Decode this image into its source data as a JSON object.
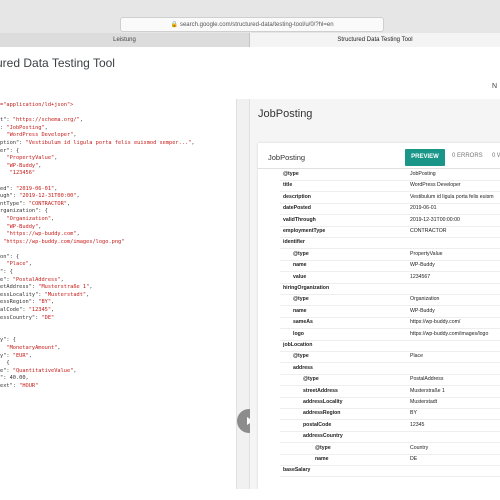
{
  "browser": {
    "url": "search.google.com/structured-data/testing-tool/u/0/?hl=en",
    "tab_left": "Leistung",
    "tab_right": "Structured Data Testing Tool"
  },
  "header": {
    "title": "ured Data Testing Tool",
    "right_letter": "N"
  },
  "code_lines": [
    "<span class=\"s\">=\"application/ld+json\"&gt;</span>",
    "",
    "t\": <span class=\"s\">\"https://schema.org/\"</span>,",
    ": <span class=\"s\">\"JobPosting\"</span>,",
    "  <span class=\"s\">\"WordPress Developer\"</span>,",
    "ption\": <span class=\"s\">\"Vestibulum id ligula porta felis euismod semper...\"</span>,",
    "er\": {",
    "  <span class=\"s\">\"PropertyValue\"</span>,",
    "  <span class=\"s\">\"WP-Buddy\"</span>,",
    "   <span class=\"s\">\"123456\"</span>",
    "",
    "ed\": <span class=\"s\">\"2019-06-01\"</span>,",
    "ugh\": <span class=\"s\">\"2019-12-31T00:00\"</span>,",
    "ntType\": <span class=\"s\">\"CONTRACTOR\"</span>,",
    "rganization\": {",
    "  <span class=\"s\">\"Organization\"</span>,",
    "  <span class=\"s\">\"WP-Buddy\"</span>,",
    "  <span class=\"s\">\"https://wp-buddy.com\"</span>,",
    " <span class=\"s\">\"https://wp-buddy.com/images/logo.png\"</span>",
    "",
    "on\": {",
    "  <span class=\"s\">\"Place\"</span>,",
    "\": {",
    "e\": <span class=\"s\">\"PostalAddress\"</span>,",
    "etAddress\": <span class=\"s\">\"Musterstraße 1\"</span>,",
    "essLocality\": <span class=\"s\">\"Musterstadt\"</span>,",
    "essRegion\": <span class=\"s\">\"BY\"</span>,",
    "alCode\": <span class=\"s\">\"12345\"</span>,",
    "essCountry\": <span class=\"s\">\"DE\"</span>",
    "",
    "",
    "y\": {",
    "  <span class=\"s\">\"MonetaryAmount\"</span>,",
    "y\": <span class=\"s\">\"EUR\"</span>,",
    "  {",
    "e\": <span class=\"s\">\"QuantitativeValue\"</span>,",
    "\": 40.00,",
    "ext\": <span class=\"s\">\"HOUR\"</span>"
  ],
  "results": {
    "title": "JobPosting",
    "card_title": "JobPosting",
    "preview_label": "PREVIEW",
    "errors_label": "0 ERRORS",
    "warnings_label": "0 W",
    "rows": [
      {
        "key": "@type",
        "value": "JobPosting",
        "indent": 0
      },
      {
        "key": "title",
        "value": "WordPress Developer",
        "indent": 0
      },
      {
        "key": "description",
        "value": "Vestibulum id ligula porta felis euism",
        "indent": 0
      },
      {
        "key": "datePosted",
        "value": "2019-06-01",
        "indent": 0
      },
      {
        "key": "validThrough",
        "value": "2019-12-31T00:00:00",
        "indent": 0
      },
      {
        "key": "employmentType",
        "value": "CONTRACTOR",
        "indent": 0
      },
      {
        "key": "identifier",
        "value": "",
        "indent": 0
      },
      {
        "key": "@type",
        "value": "PropertyValue",
        "indent": 1
      },
      {
        "key": "name",
        "value": "WP-Buddy",
        "indent": 1
      },
      {
        "key": "value",
        "value": "1234567",
        "indent": 1
      },
      {
        "key": "hiringOrganization",
        "value": "",
        "indent": 0
      },
      {
        "key": "@type",
        "value": "Organization",
        "indent": 1
      },
      {
        "key": "name",
        "value": "WP-Buddy",
        "indent": 1
      },
      {
        "key": "sameAs",
        "value": "https://wp-buddy.com/",
        "indent": 1
      },
      {
        "key": "logo",
        "value": "https://wp-buddy.com/images/logo",
        "indent": 1
      },
      {
        "key": "jobLocation",
        "value": "",
        "indent": 0
      },
      {
        "key": "@type",
        "value": "Place",
        "indent": 1
      },
      {
        "key": "address",
        "value": "",
        "indent": 1
      },
      {
        "key": "@type",
        "value": "PostalAddress",
        "indent": 2
      },
      {
        "key": "streetAddress",
        "value": "Musterstraße 1",
        "indent": 2
      },
      {
        "key": "addressLocality",
        "value": "Musterstadt",
        "indent": 2
      },
      {
        "key": "addressRegion",
        "value": "BY",
        "indent": 2
      },
      {
        "key": "postalCode",
        "value": "12345",
        "indent": 2
      },
      {
        "key": "addressCountry",
        "value": "",
        "indent": 2
      },
      {
        "key": "@type",
        "value": "Country",
        "indent": 3
      },
      {
        "key": "name",
        "value": "DE",
        "indent": 3
      },
      {
        "key": "baseSalary",
        "value": "",
        "indent": 0
      }
    ]
  },
  "colors": {
    "preview": "#199688",
    "string": "#c41a16"
  }
}
